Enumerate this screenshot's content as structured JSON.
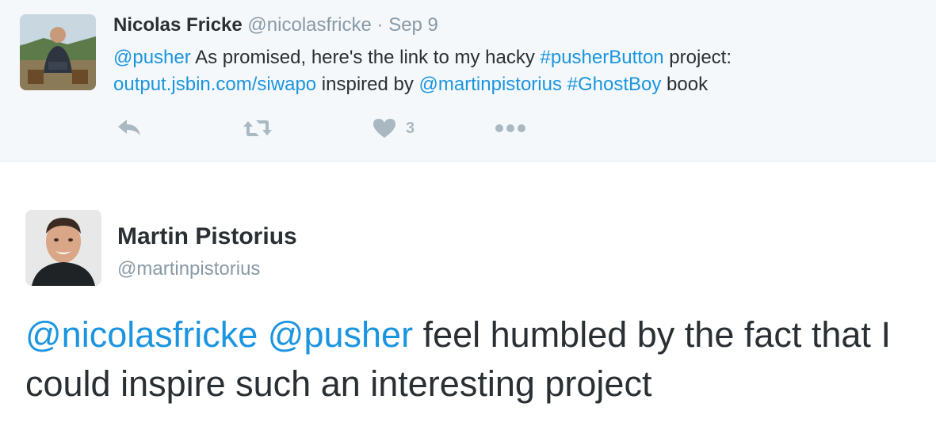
{
  "parent_tweet": {
    "author_name": "Nicolas Fricke",
    "author_handle": "@nicolasfricke",
    "separator": "·",
    "date": "Sep 9",
    "mention": "@pusher",
    "text_a": " As promised, here's the link to my hacky ",
    "hashtag1": "#pusherButton",
    "text_b": " project:",
    "link_url": "output.jsbin.com/siwapo",
    "text_c": " inspired by ",
    "mention2": "@martinpistorius",
    "text_d": " ",
    "hashtag2": "#GhostBoy",
    "text_e": " book",
    "like_count": "3",
    "icons": [
      "reply-icon",
      "retweet-icon",
      "heart-icon",
      "more-icon"
    ]
  },
  "reply_tweet": {
    "author_name": "Martin Pistorius",
    "author_handle": "@martinpistorius",
    "mention1": "@nicolasfricke",
    "space": " ",
    "mention2": "@pusher",
    "text": " feel humbled by the fact that I could inspire such an interesting project"
  },
  "colors": {
    "link": "#1b95e0",
    "muted": "#8899a6",
    "icon": "#aab8c2",
    "parent_bg": "#f5f8fa"
  }
}
